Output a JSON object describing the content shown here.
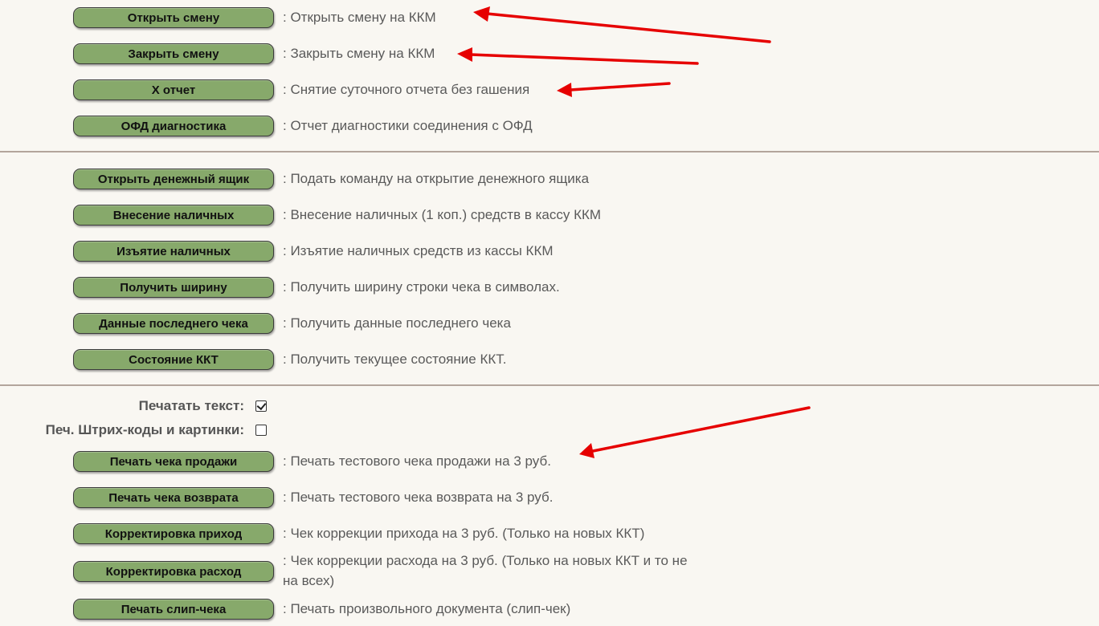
{
  "section1": [
    {
      "label": "Открыть смену",
      "desc": ": Открыть смену на ККМ"
    },
    {
      "label": "Закрыть смену",
      "desc": ": Закрыть смену на ККМ"
    },
    {
      "label": "X отчет",
      "desc": ": Снятие суточного отчета без гашения"
    },
    {
      "label": "ОФД диагностика",
      "desc": ": Отчет диагностики соединения с ОФД"
    }
  ],
  "section2": [
    {
      "label": "Открыть денежный ящик",
      "desc": ": Подать команду на открытие денежного ящика"
    },
    {
      "label": "Внесение наличных",
      "desc": ": Внесение наличных (1 коп.) средств в кассу ККМ"
    },
    {
      "label": "Изъятие наличных",
      "desc": ": Изъятие наличных средств из кассы ККМ"
    },
    {
      "label": "Получить ширину",
      "desc": ": Получить ширину строки чека в символах."
    },
    {
      "label": "Данные последнего чека",
      "desc": ": Получить данные последнего чека"
    },
    {
      "label": "Состояние ККТ",
      "desc": ": Получить текущее состояние ККТ."
    }
  ],
  "options": {
    "print_text": {
      "label": "Печатать текст:",
      "checked": true
    },
    "print_barcodes": {
      "label": "Печ. Штрих-коды и картинки:",
      "checked": false
    }
  },
  "section3": [
    {
      "label": "Печать чека продажи",
      "desc": ": Печать тестового чека продажи на 3 руб."
    },
    {
      "label": "Печать чека возврата",
      "desc": ": Печать тестового чека возврата на 3 руб."
    },
    {
      "label": "Корректировка приход",
      "desc": ": Чек коррекции прихода на 3 руб. (Только на новых ККТ)"
    },
    {
      "label": "Корректировка расход",
      "desc": ": Чек коррекции расхода на 3 руб. (Только на новых ККТ и то не на всех)"
    },
    {
      "label": "Печать слип-чека",
      "desc": ": Печать произвольного документа (слип-чек)"
    }
  ],
  "colors": {
    "button_bg": "#87a96b",
    "divider": "#b3a59c",
    "arrow": "#e60000",
    "background": "#f9f7f2"
  }
}
